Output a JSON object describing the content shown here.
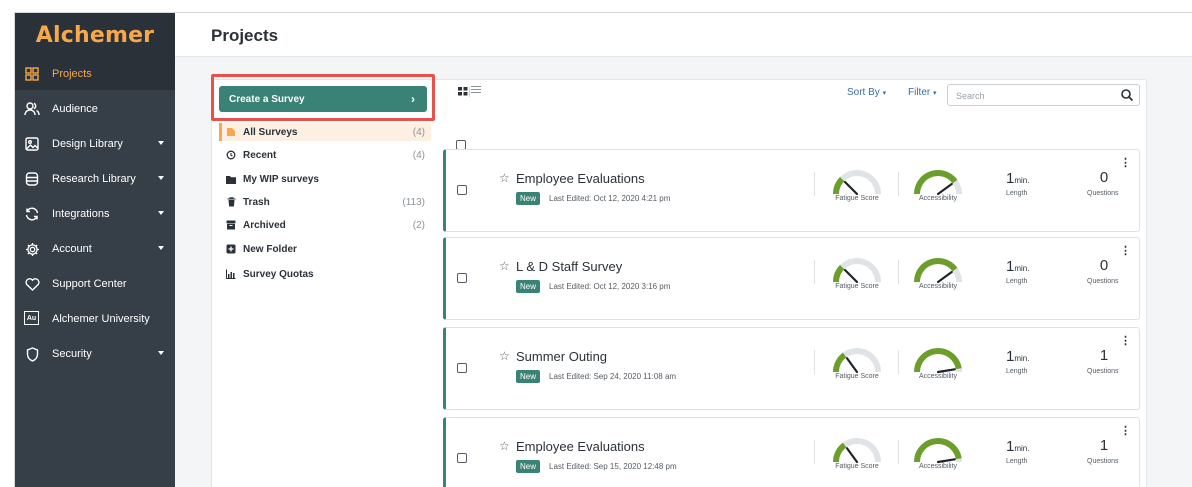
{
  "app": {
    "logo_text": "Alchemer",
    "page_title": "Projects",
    "accent_color": "#f6a84a",
    "primary_color": "#3a8275"
  },
  "sidebar": {
    "items": [
      {
        "label": "Projects",
        "icon": "grid-icon",
        "active": true,
        "has_caret": false
      },
      {
        "label": "Audience",
        "icon": "users-icon",
        "active": false,
        "has_caret": false
      },
      {
        "label": "Design Library",
        "icon": "image-icon",
        "active": false,
        "has_caret": true
      },
      {
        "label": "Research Library",
        "icon": "database-icon",
        "active": false,
        "has_caret": true
      },
      {
        "label": "Integrations",
        "icon": "refresh-icon",
        "active": false,
        "has_caret": true
      },
      {
        "label": "Account",
        "icon": "gear-icon",
        "active": false,
        "has_caret": true
      },
      {
        "label": "Support Center",
        "icon": "heart-icon",
        "active": false,
        "has_caret": false
      },
      {
        "label": "Alchemer University",
        "icon": "au-badge-icon",
        "icon_text": "Au",
        "active": false,
        "has_caret": false
      },
      {
        "label": "Security",
        "icon": "shield-icon",
        "active": false,
        "has_caret": true
      }
    ]
  },
  "folders": {
    "create_button": "Create a Survey",
    "items": [
      {
        "label": "All Surveys",
        "count": "(4)",
        "icon": "folder-orange-icon",
        "active": true
      },
      {
        "label": "Recent",
        "count": "(4)",
        "icon": "clock-icon",
        "active": false
      },
      {
        "label": "My WIP surveys",
        "count": "",
        "icon": "folder-icon",
        "active": false
      },
      {
        "label": "Trash",
        "count": "(113)",
        "icon": "trash-icon",
        "active": false
      },
      {
        "label": "Archived",
        "count": "(2)",
        "icon": "archive-icon",
        "active": false
      },
      {
        "label": "New Folder",
        "count": "",
        "icon": "plus-square-icon",
        "active": false
      },
      {
        "label": "Survey Quotas",
        "count": "",
        "icon": "bar-chart-icon",
        "active": false
      }
    ]
  },
  "toolbar": {
    "sort_by": "Sort By",
    "filter": "Filter",
    "search_placeholder": "Search"
  },
  "surveys": [
    {
      "title": "Employee Evaluations",
      "badge": "New",
      "last_edited": "Last Edited: Oct 12, 2020 4:21 pm",
      "fatigue_label": "Fatigue Score",
      "accessibility_label": "Accessibility",
      "length_value": "1",
      "length_unit": "min.",
      "length_label": "Length",
      "questions_value": "0",
      "questions_label": "Questions",
      "fatigue_level": 0.25,
      "accessibility_level": 0.8
    },
    {
      "title": "L & D Staff Survey",
      "badge": "New",
      "last_edited": "Last Edited: Oct 12, 2020 3:16 pm",
      "fatigue_label": "Fatigue Score",
      "accessibility_label": "Accessibility",
      "length_value": "1",
      "length_unit": "min.",
      "length_label": "Length",
      "questions_value": "0",
      "questions_label": "Questions",
      "fatigue_level": 0.25,
      "accessibility_level": 0.8
    },
    {
      "title": "Summer Outing",
      "badge": "New",
      "last_edited": "Last Edited: Sep 24, 2020 11:08 am",
      "fatigue_label": "Fatigue Score",
      "accessibility_label": "Accessibility",
      "length_value": "1",
      "length_unit": "min.",
      "length_label": "Length",
      "questions_value": "1",
      "questions_label": "Questions",
      "fatigue_level": 0.3,
      "accessibility_level": 0.95
    },
    {
      "title": "Employee Evaluations",
      "badge": "New",
      "last_edited": "Last Edited: Sep 15, 2020 12:48 pm",
      "fatigue_label": "Fatigue Score",
      "accessibility_label": "Accessibility",
      "length_value": "1",
      "length_unit": "min.",
      "length_label": "Length",
      "questions_value": "1",
      "questions_label": "Questions",
      "fatigue_level": 0.3,
      "accessibility_level": 0.95
    }
  ]
}
